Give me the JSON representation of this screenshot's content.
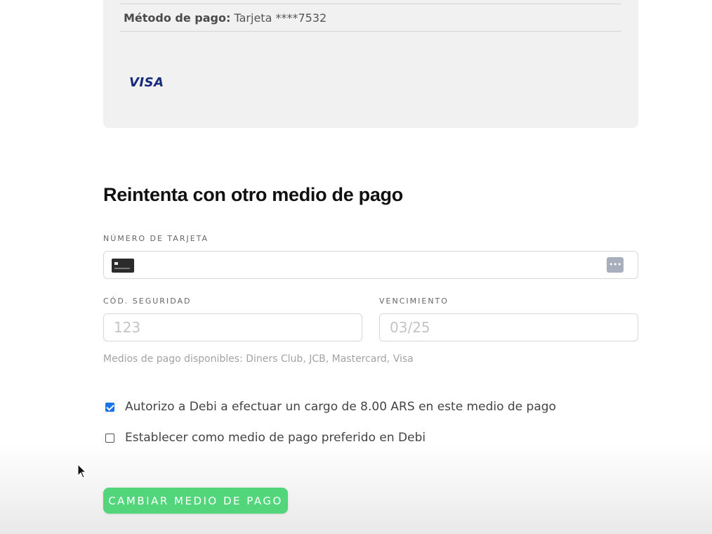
{
  "summary": {
    "payment_method_label": "Método de pago:",
    "payment_method_value": "Tarjeta ****7532",
    "card_brand": "VISA"
  },
  "retry_form": {
    "title": "Reintenta con otro medio de pago",
    "card_number": {
      "label": "NÚMERO DE TARJETA",
      "value": "",
      "placeholder": ""
    },
    "security_code": {
      "label": "CÓD. SEGURIDAD",
      "value": "",
      "placeholder": "123"
    },
    "expiration": {
      "label": "VENCIMIENTO",
      "value": "",
      "placeholder": "03/25"
    },
    "cvc_badge": "•••",
    "helper_text": "Medios de pago disponibles: Diners Club, JCB, Mastercard, Visa",
    "checkboxes": [
      {
        "label": "Autorizo a Debi a efectuar un cargo de 8.00 ARS en este medio de pago",
        "checked": true
      },
      {
        "label": "Establecer como medio de pago preferido en Debi",
        "checked": false
      }
    ],
    "submit_label": "CAMBIAR MEDIO DE PAGO"
  },
  "colors": {
    "accent_green": "#52d57b",
    "checkbox_blue": "#1a73e8",
    "card_background": "#f1f1f1",
    "visa_blue": "#1a2a7a"
  },
  "icons": {
    "card": "credit-card-icon",
    "cvc": "cvc-dots-icon",
    "cursor": "mouse-pointer-icon"
  }
}
